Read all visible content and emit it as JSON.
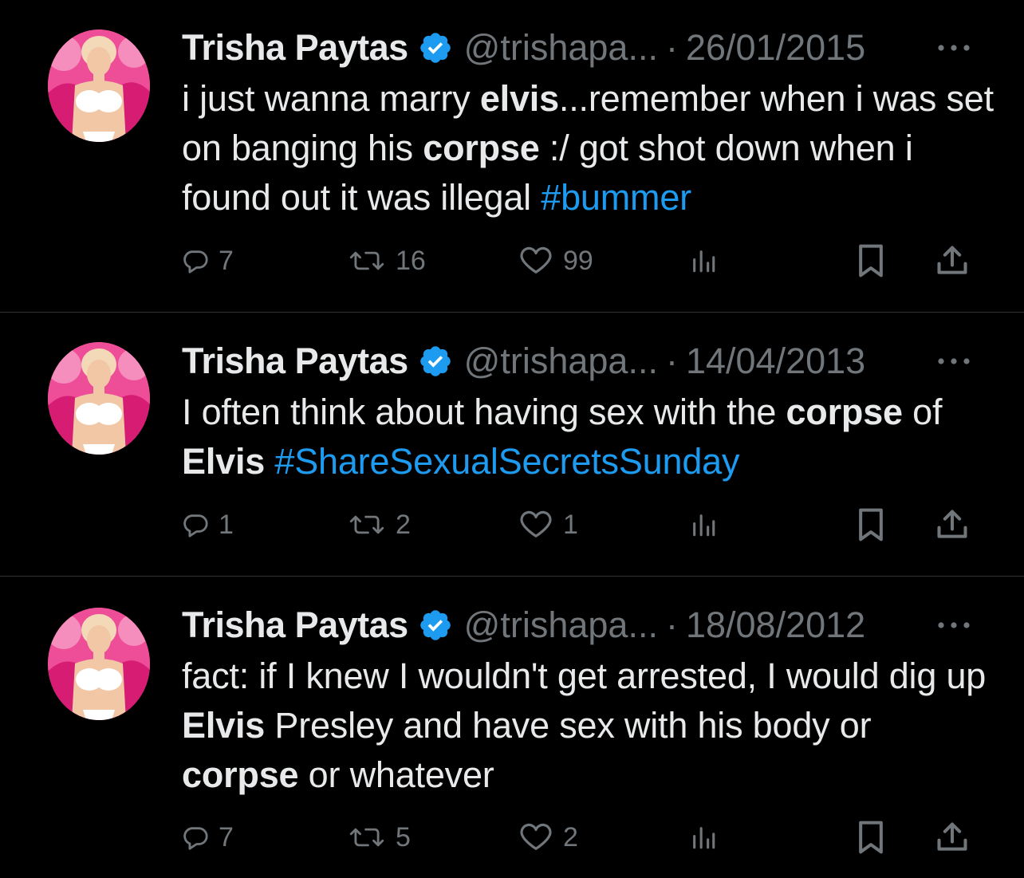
{
  "tweets": [
    {
      "author": {
        "name": "Trisha Paytas",
        "handle": "@trishapa...",
        "verified": true
      },
      "separator": "·",
      "date": "26/01/2015",
      "text": {
        "p1": "i just wanna marry ",
        "b1": "elvis",
        "p2": "...remember when i was set on banging his ",
        "b2": "corpse",
        "p3": " :/ got shot down when i found out it was illegal ",
        "hashtag": "#bummer"
      },
      "stats": {
        "replies": "7",
        "retweets": "16",
        "likes": "99"
      }
    },
    {
      "author": {
        "name": "Trisha Paytas",
        "handle": "@trishapa...",
        "verified": true
      },
      "separator": "·",
      "date": "14/04/2013",
      "text": {
        "p1": "I often think about having sex with the ",
        "b1": "corpse",
        "p2": " of ",
        "b2": "Elvis",
        "p3": " ",
        "hashtag": "#ShareSexualSecretsSunday"
      },
      "stats": {
        "replies": "1",
        "retweets": "2",
        "likes": "1"
      }
    },
    {
      "author": {
        "name": "Trisha Paytas",
        "handle": "@trishapa...",
        "verified": true
      },
      "separator": "·",
      "date": "18/08/2012",
      "text": {
        "p1": "fact: if I knew I wouldn't get arrested, I would dig up ",
        "b1": "Elvis",
        "p2": " Presley and have sex with his body or ",
        "b2": "corpse",
        "p3": " or whatever",
        "hashtag": ""
      },
      "stats": {
        "replies": "7",
        "retweets": "5",
        "likes": "2"
      }
    }
  ],
  "icons": {
    "verified": "verified-badge-icon",
    "more": "more-horizontal-icon",
    "reply": "reply-bubble-icon",
    "retweet": "retweet-icon",
    "like": "heart-icon",
    "views": "analytics-bars-icon",
    "bookmark": "bookmark-icon",
    "share": "share-upload-icon"
  },
  "colors": {
    "background": "#000000",
    "text": "#e7e9ea",
    "secondary": "#71767b",
    "hashtag": "#1d9bf0",
    "verified": "#1d9bf0",
    "divider": "#2f3336"
  }
}
